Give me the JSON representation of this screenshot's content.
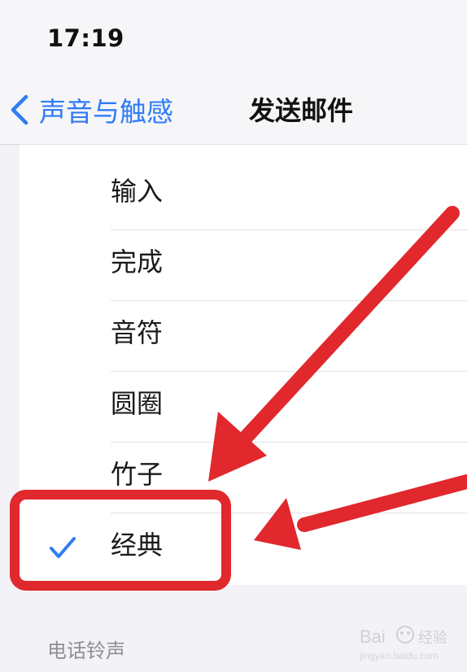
{
  "status_bar": {
    "time": "17:19"
  },
  "nav": {
    "back_label": "声音与触感",
    "title": "发送邮件"
  },
  "sounds": {
    "items": [
      {
        "label": "输入",
        "selected": false
      },
      {
        "label": "完成",
        "selected": false
      },
      {
        "label": "音符",
        "selected": false
      },
      {
        "label": "圆圈",
        "selected": false
      },
      {
        "label": "竹子",
        "selected": false
      },
      {
        "label": "经典",
        "selected": true
      }
    ]
  },
  "section": {
    "header": "电话铃声"
  },
  "watermark": {
    "text": "Bai 经验 jingyan.baidu.com"
  },
  "colors": {
    "accent": "#2f7cf6",
    "annotation_red": "#e0282d",
    "background": "#f2f2f7"
  },
  "icons": {
    "back": "chevron-left-icon",
    "check": "checkmark-icon"
  }
}
